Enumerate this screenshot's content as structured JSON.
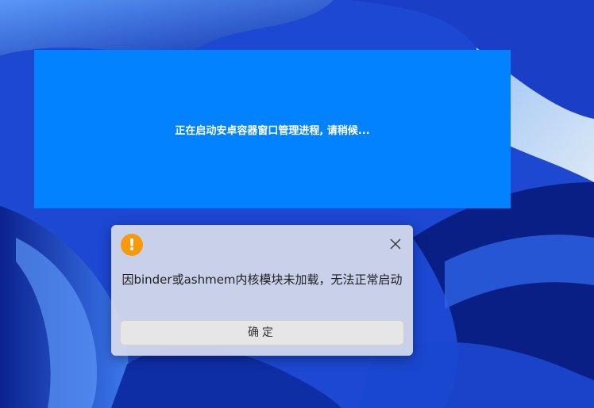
{
  "desktop": {
    "wallpaper_colors": {
      "primary": "#1f4fd9",
      "deep": "#0d2a9e",
      "light": "#4b8cf5",
      "pale": "#c9dcf5"
    }
  },
  "loading_window": {
    "message": "正在启动安卓容器窗口管理进程, 请稍候...",
    "background": "#0282fe"
  },
  "dialog": {
    "icon": "warning-icon",
    "icon_glyph": "!",
    "icon_color": "#f59a0c",
    "close_icon": "close-icon",
    "message": "因binder或ashmem内核模块未加载，无法正常启动",
    "confirm_label": "确定"
  }
}
